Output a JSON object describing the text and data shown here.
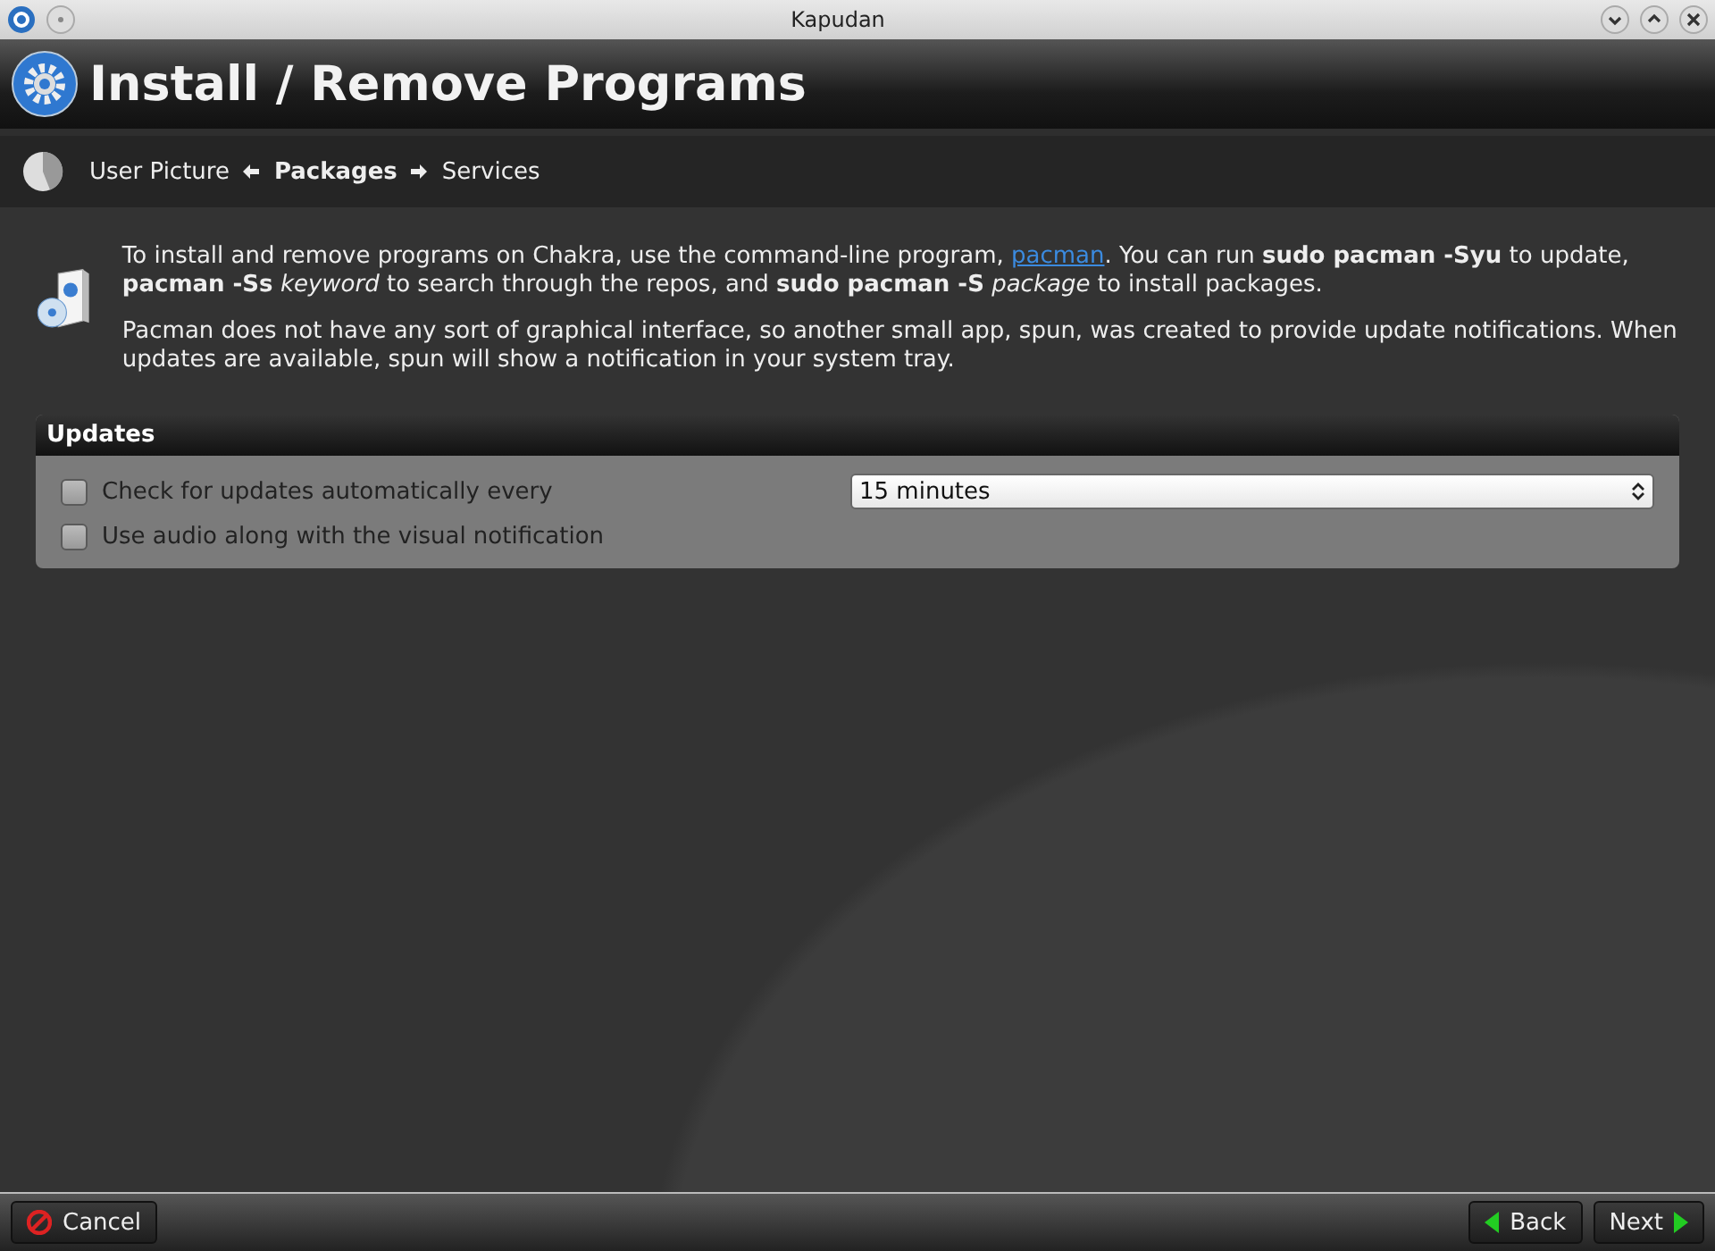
{
  "window": {
    "title": "Kapudan"
  },
  "header": {
    "title": "Install / Remove Programs"
  },
  "breadcrumb": [
    {
      "label": "User Picture",
      "selected": false
    },
    {
      "label": "Packages",
      "selected": true
    },
    {
      "label": "Services",
      "selected": false
    }
  ],
  "intro": {
    "before": "To install and remove programs on Chakra, use the command-line program, ",
    "link": "pacman",
    "after": ". You can run **sudo pacman -Syu** to update, **pacman -Ss** *keyword* to search through the repos, and **sudo pacman -S** *package* to install packages.",
    "note": "Pacman does not have any sort of graphical interface, so another small app, spun, was created to provide update notifications. When updates are available, spun will show a notification in your system tray."
  },
  "updates": {
    "title": "Updates",
    "options": [
      {
        "label": "Check for updates automatically every",
        "checked": false
      },
      {
        "label": "Use audio along with the visual notification",
        "checked": false
      }
    ],
    "interval": "15 minutes"
  },
  "buttons": {
    "cancel": "Cancel",
    "back": "Back",
    "next": "Next"
  }
}
